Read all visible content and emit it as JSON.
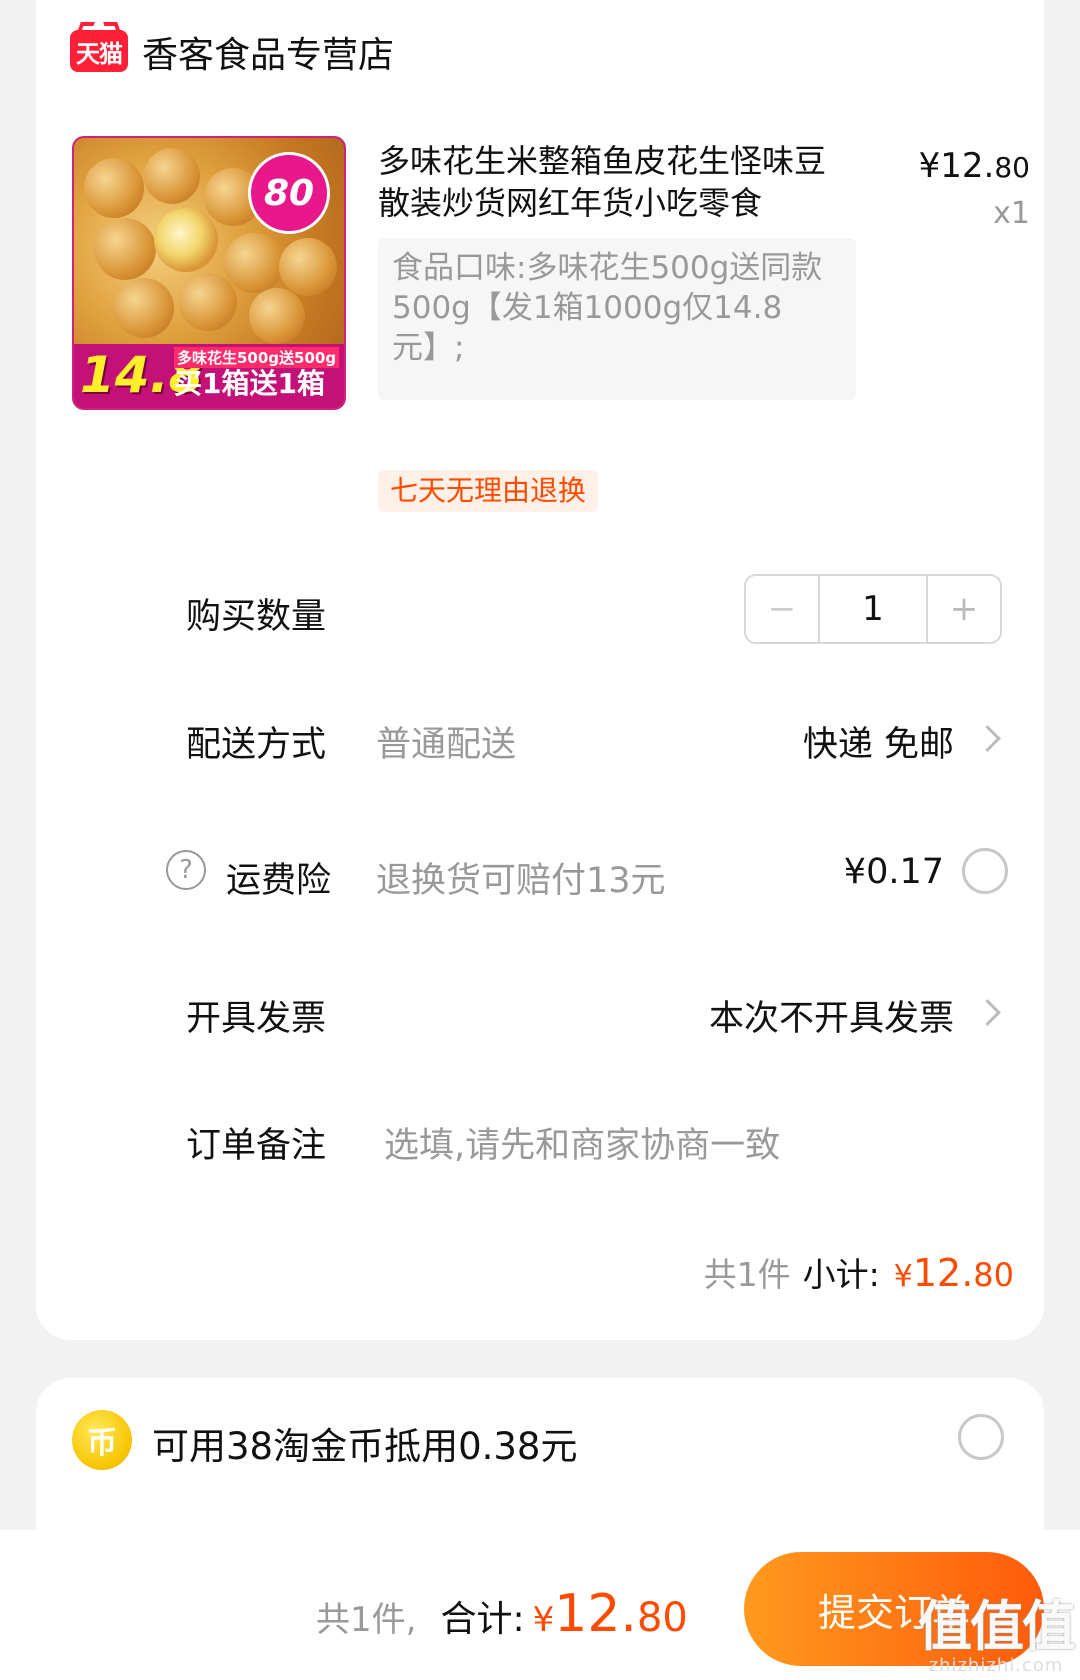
{
  "store": {
    "logo_text": "天猫",
    "name": "香客食品专营店"
  },
  "product": {
    "title": "多味花生米整箱鱼皮花生怪味豆散装炒货网红年货小吃零食",
    "price_symbol": "¥",
    "price_int": "12.",
    "price_dec": "80",
    "quantity_text": "x1",
    "sku": "食品口味:多味花生500g送同款500g【发1箱1000g仅14.8元】;",
    "return_tag": "七天无理由退换",
    "image": {
      "badge": "80",
      "price": "14.8",
      "top_line": "多味花生500g送500g",
      "promo": "买1箱送1箱"
    }
  },
  "quantity_row": {
    "label": "购买数量",
    "minus": "−",
    "value": "1",
    "plus": "+"
  },
  "delivery_row": {
    "label": "配送方式",
    "sub": "普通配送",
    "value": "快递 免邮"
  },
  "insurance_row": {
    "label": "运费险",
    "sub": "退换货可赔付13元",
    "value": "¥0.17"
  },
  "invoice_row": {
    "label": "开具发票",
    "value": "本次不开具发票"
  },
  "note_row": {
    "label": "订单备注",
    "placeholder": "选填,请先和商家协商一致"
  },
  "subtotal": {
    "count_text": "共1件",
    "label": "小计:",
    "symbol": "¥",
    "int": "12.",
    "dec": "80"
  },
  "coin": {
    "icon": "币",
    "text": "可用38淘金币抵用0.38元"
  },
  "footer": {
    "count_text": "共1件,",
    "label": "合计:",
    "symbol": "¥",
    "int": "12.",
    "dec": "80",
    "submit": "提交订单"
  },
  "watermark": {
    "big": "值值值",
    "small": "zhizhizhi.com"
  },
  "colors": {
    "accent": "#ff4a00",
    "button_start": "#ff9a1e",
    "button_end": "#ff5a0a",
    "tmall_red": "#ff1f36"
  }
}
